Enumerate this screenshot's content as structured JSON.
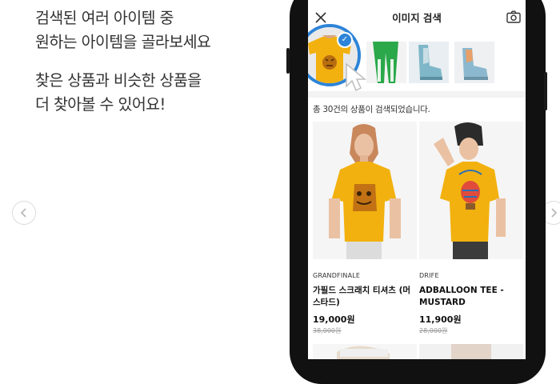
{
  "promo": {
    "lines1": [
      "검색된 여러 아이템 중",
      "원하는 아이템을 골라보세요"
    ],
    "lines2": [
      "찾은 상품과 비슷한 상품을",
      "더 찾아볼 수 있어요!"
    ]
  },
  "carousel": {
    "prev_icon": "chevron-left-icon",
    "next_icon": "chevron-right-icon"
  },
  "app": {
    "title": "이미지 검색",
    "result_count": "총 30건의 상품이 검색되었습니다.",
    "accent_color": "#2d84d8",
    "products": [
      {
        "brand": "GRANDFINALE",
        "name": "가필드 스크래치 티셔츠 (머스타드)",
        "price": "19,000원",
        "original_price": "38,000원"
      },
      {
        "brand": "DRIFE",
        "name": "ADBALLOON TEE - MUSTARD",
        "price": "11,900원",
        "original_price": "28,000원"
      }
    ]
  }
}
